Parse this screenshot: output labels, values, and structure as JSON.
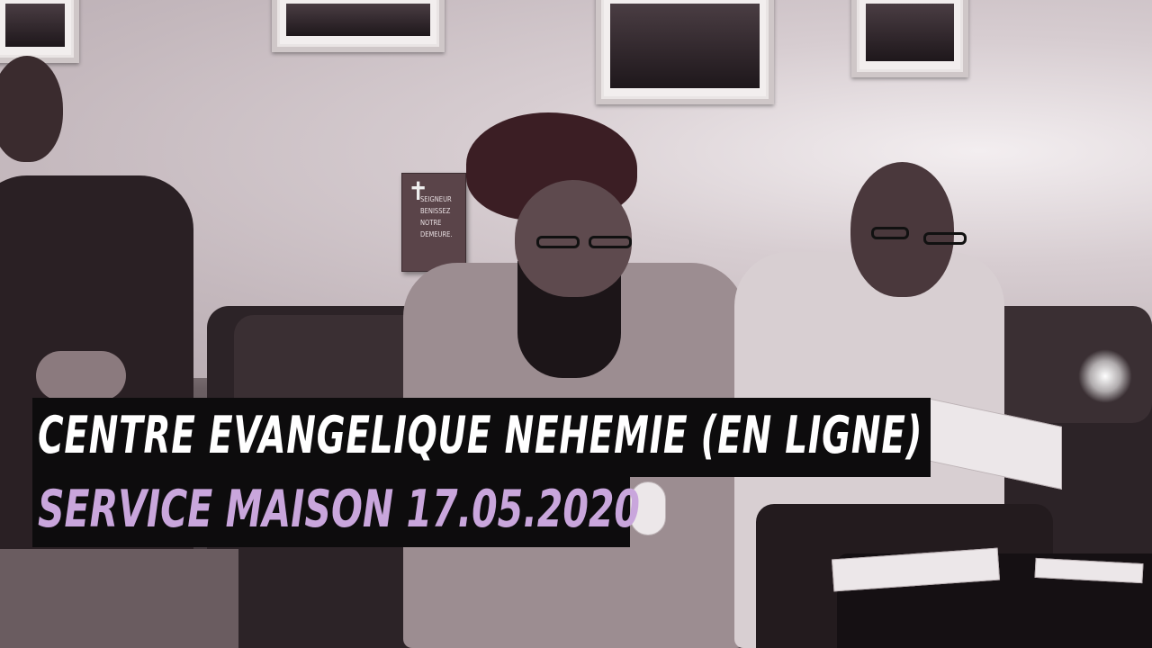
{
  "plaque": {
    "text": "SEIGNEUR BENISSEZ NOTRE DEMEURE.",
    "icon": "cross-icon"
  },
  "caption": {
    "line1": "CENTRE  EVANGELIQUE NEHEMIE (EN LIGNE)",
    "line2": "SERVICE MAISON 17.05.2020",
    "line1_color": "#ffffff",
    "line2_color": "#c9a6dc",
    "background": "#0d0c0d"
  }
}
